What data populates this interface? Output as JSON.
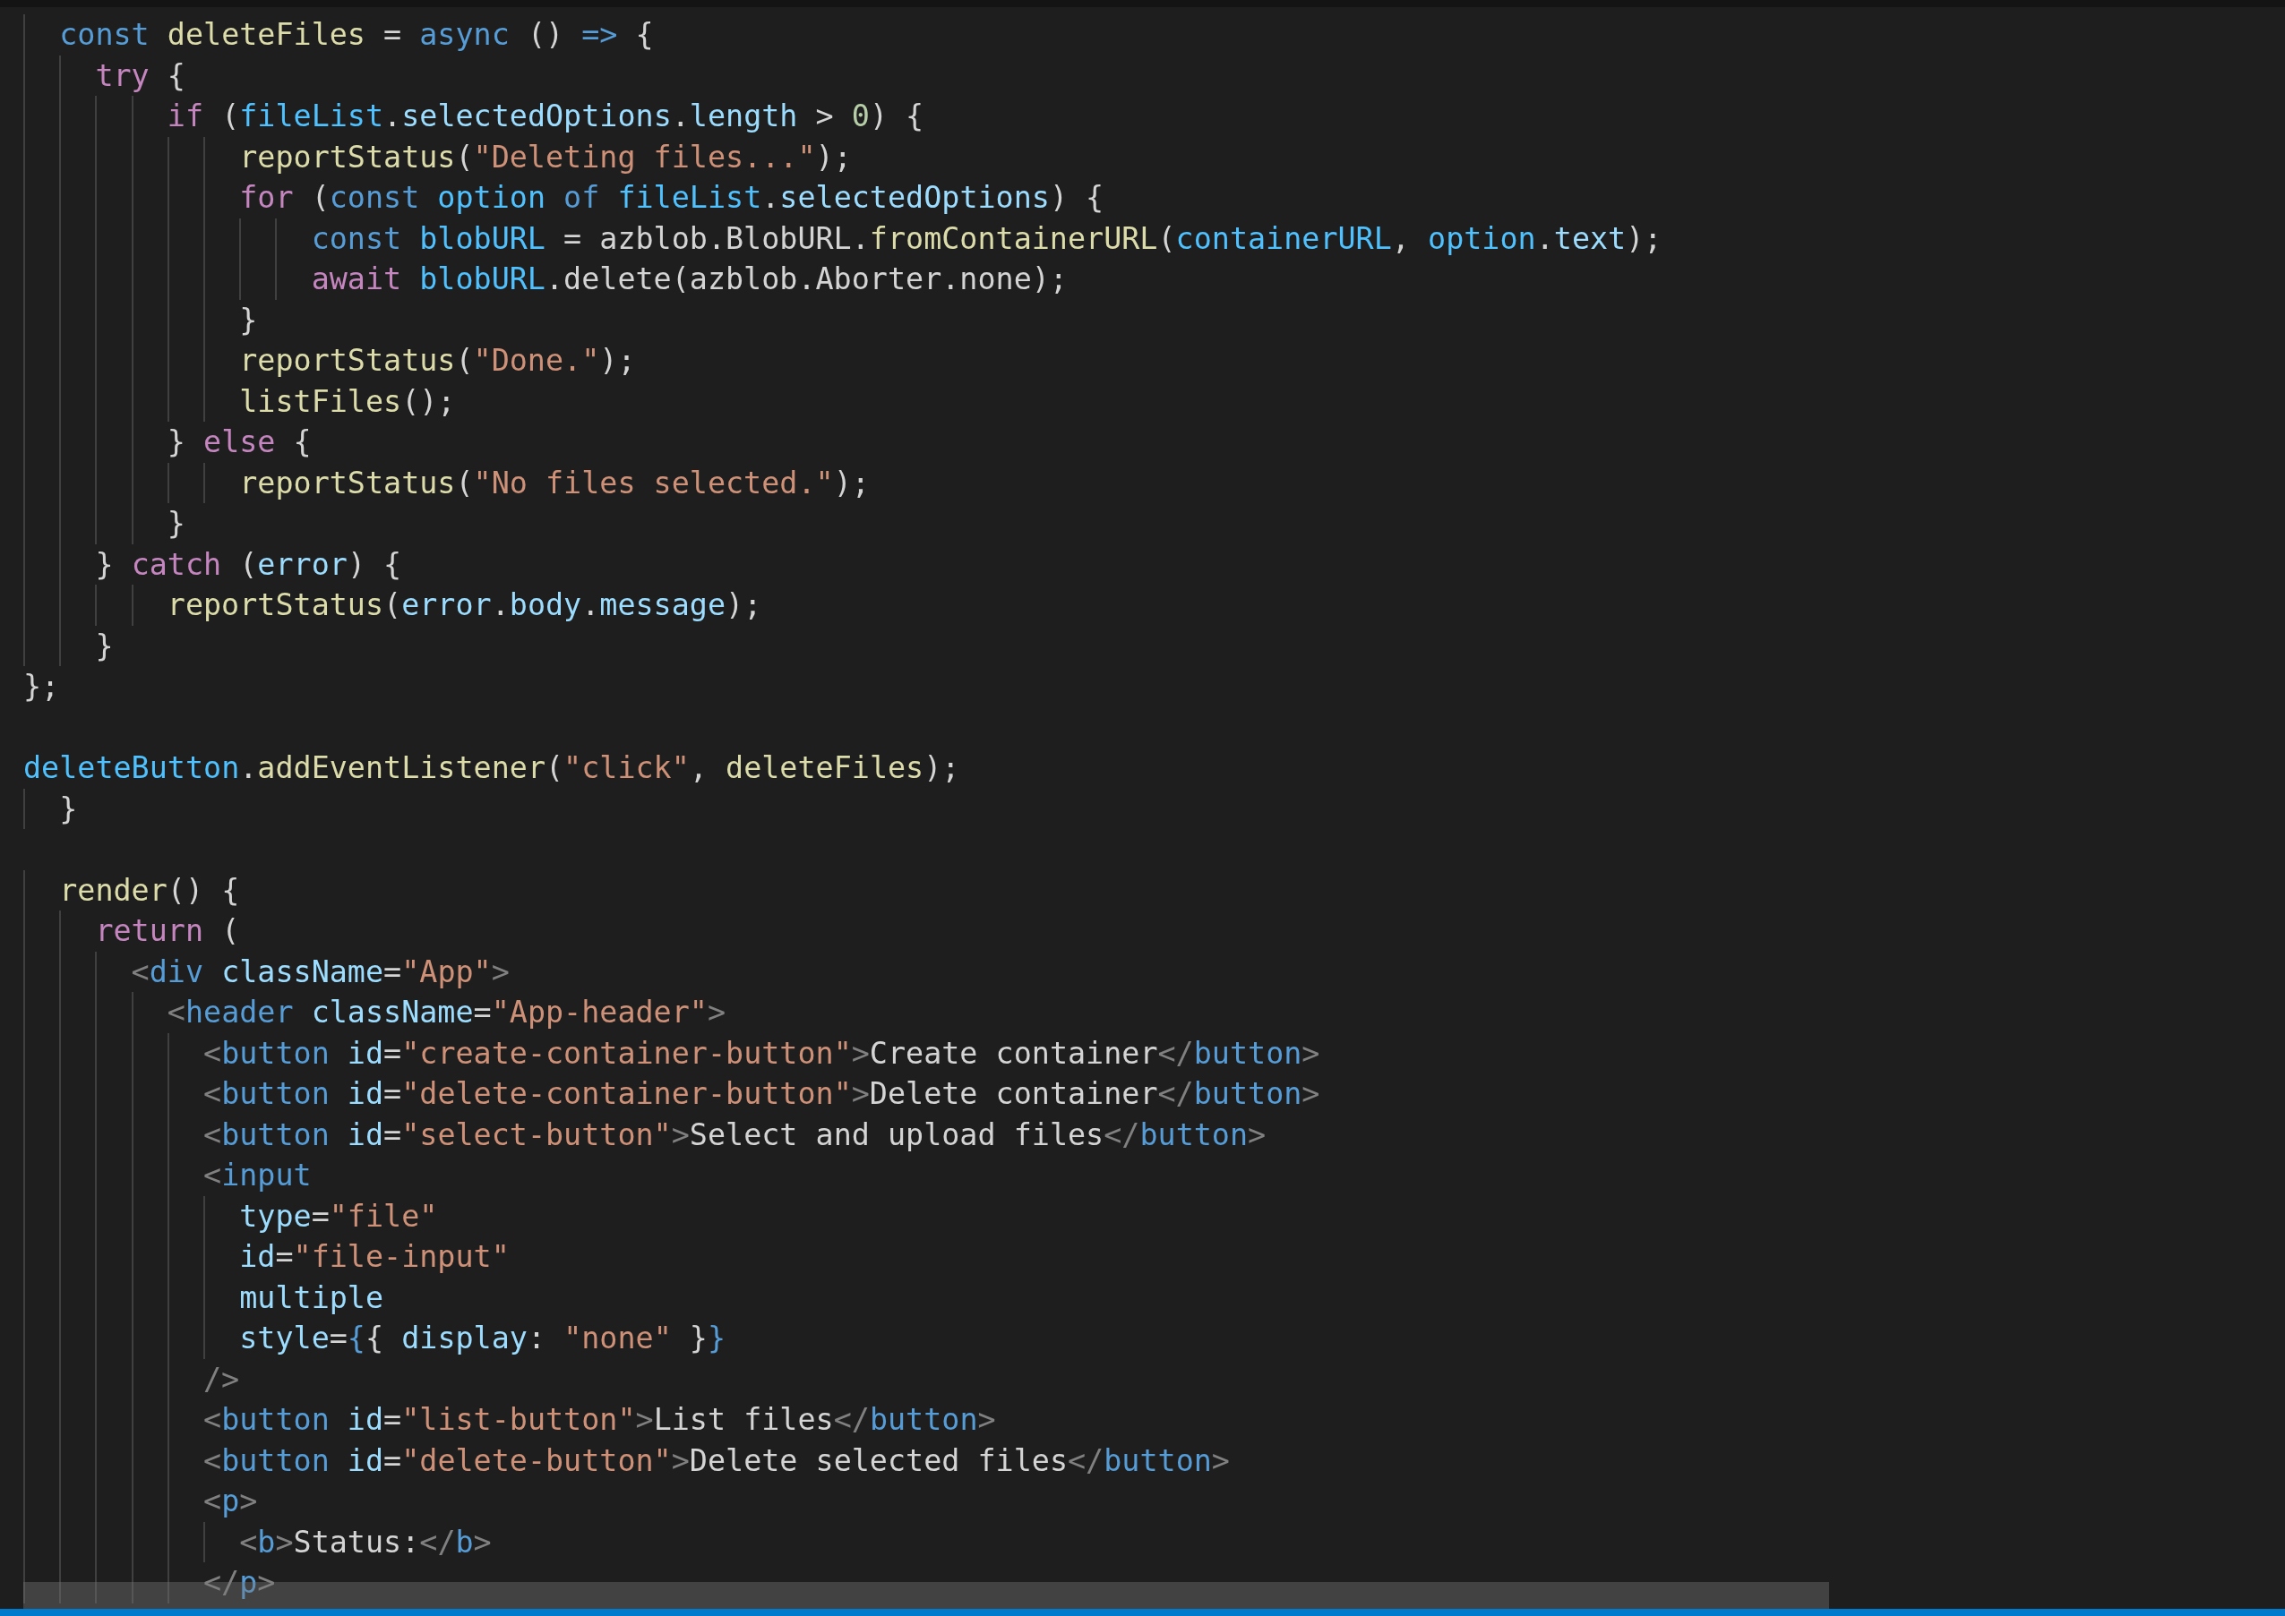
{
  "editor": {
    "lines": [
      {
        "tokens": [
          {
            "kind": "storage",
            "text": "  const"
          },
          {
            "kind": "fn",
            "text": " deleteFiles"
          },
          {
            "kind": "plain",
            "text": " = "
          },
          {
            "kind": "storage",
            "text": "async"
          },
          {
            "kind": "plain",
            "text": " () "
          },
          {
            "kind": "storage",
            "text": "=>"
          },
          {
            "kind": "plain",
            "text": " {"
          }
        ]
      },
      {
        "tokens": [
          {
            "kind": "kw",
            "text": "    try"
          },
          {
            "kind": "plain",
            "text": " {"
          }
        ]
      },
      {
        "tokens": [
          {
            "kind": "kw",
            "text": "        if"
          },
          {
            "kind": "plain",
            "text": " ("
          },
          {
            "kind": "const",
            "text": "fileList"
          },
          {
            "kind": "plain",
            "text": "."
          },
          {
            "kind": "var",
            "text": "selectedOptions"
          },
          {
            "kind": "plain",
            "text": "."
          },
          {
            "kind": "var",
            "text": "length"
          },
          {
            "kind": "plain",
            "text": " > "
          },
          {
            "kind": "num",
            "text": "0"
          },
          {
            "kind": "plain",
            "text": ") {"
          }
        ]
      },
      {
        "tokens": [
          {
            "kind": "fn",
            "text": "            reportStatus"
          },
          {
            "kind": "plain",
            "text": "("
          },
          {
            "kind": "str",
            "text": "\"Deleting files...\""
          },
          {
            "kind": "plain",
            "text": ");"
          }
        ]
      },
      {
        "tokens": [
          {
            "kind": "kw",
            "text": "            for"
          },
          {
            "kind": "plain",
            "text": " ("
          },
          {
            "kind": "storage",
            "text": "const"
          },
          {
            "kind": "const",
            "text": " option"
          },
          {
            "kind": "storage",
            "text": " of"
          },
          {
            "kind": "const",
            "text": " fileList"
          },
          {
            "kind": "plain",
            "text": "."
          },
          {
            "kind": "var",
            "text": "selectedOptions"
          },
          {
            "kind": "plain",
            "text": ") {"
          }
        ]
      },
      {
        "tokens": [
          {
            "kind": "storage",
            "text": "                const"
          },
          {
            "kind": "const",
            "text": " blobURL"
          },
          {
            "kind": "plain",
            "text": " = azblob.BlobURL."
          },
          {
            "kind": "fn",
            "text": "fromContainerURL"
          },
          {
            "kind": "plain",
            "text": "("
          },
          {
            "kind": "const",
            "text": "containerURL"
          },
          {
            "kind": "plain",
            "text": ", "
          },
          {
            "kind": "const",
            "text": "option"
          },
          {
            "kind": "plain",
            "text": "."
          },
          {
            "kind": "var",
            "text": "text"
          },
          {
            "kind": "plain",
            "text": ");"
          }
        ]
      },
      {
        "tokens": [
          {
            "kind": "kw",
            "text": "                await"
          },
          {
            "kind": "const",
            "text": " blobURL"
          },
          {
            "kind": "plain",
            "text": ".delete("
          },
          {
            "kind": "plain",
            "text": "azblob.Aborter.none);"
          }
        ]
      },
      {
        "tokens": [
          {
            "kind": "plain",
            "text": "            }"
          }
        ]
      },
      {
        "tokens": [
          {
            "kind": "fn",
            "text": "            reportStatus"
          },
          {
            "kind": "plain",
            "text": "("
          },
          {
            "kind": "str",
            "text": "\"Done.\""
          },
          {
            "kind": "plain",
            "text": ");"
          }
        ]
      },
      {
        "tokens": [
          {
            "kind": "fn",
            "text": "            listFiles"
          },
          {
            "kind": "plain",
            "text": "();"
          }
        ]
      },
      {
        "tokens": [
          {
            "kind": "plain",
            "text": "        } "
          },
          {
            "kind": "kw",
            "text": "else"
          },
          {
            "kind": "plain",
            "text": " {"
          }
        ]
      },
      {
        "tokens": [
          {
            "kind": "fn",
            "text": "            reportStatus"
          },
          {
            "kind": "plain",
            "text": "("
          },
          {
            "kind": "str",
            "text": "\"No files selected.\""
          },
          {
            "kind": "plain",
            "text": ");"
          }
        ]
      },
      {
        "tokens": [
          {
            "kind": "plain",
            "text": "        }"
          }
        ]
      },
      {
        "tokens": [
          {
            "kind": "plain",
            "text": "    } "
          },
          {
            "kind": "kw",
            "text": "catch"
          },
          {
            "kind": "plain",
            "text": " ("
          },
          {
            "kind": "var",
            "text": "error"
          },
          {
            "kind": "plain",
            "text": ") {"
          }
        ]
      },
      {
        "tokens": [
          {
            "kind": "fn",
            "text": "        reportStatus"
          },
          {
            "kind": "plain",
            "text": "("
          },
          {
            "kind": "var",
            "text": "error"
          },
          {
            "kind": "plain",
            "text": "."
          },
          {
            "kind": "var",
            "text": "body"
          },
          {
            "kind": "plain",
            "text": "."
          },
          {
            "kind": "var",
            "text": "message"
          },
          {
            "kind": "plain",
            "text": ");"
          }
        ]
      },
      {
        "tokens": [
          {
            "kind": "plain",
            "text": "    }"
          }
        ]
      },
      {
        "tokens": [
          {
            "kind": "plain",
            "text": "};"
          }
        ]
      },
      {
        "kind": "blank"
      },
      {
        "tokens": [
          {
            "kind": "const",
            "text": "deleteButton"
          },
          {
            "kind": "plain",
            "text": "."
          },
          {
            "kind": "fn",
            "text": "addEventListener"
          },
          {
            "kind": "plain",
            "text": "("
          },
          {
            "kind": "str",
            "text": "\"click\""
          },
          {
            "kind": "plain",
            "text": ", "
          },
          {
            "kind": "fn",
            "text": "deleteFiles"
          },
          {
            "kind": "plain",
            "text": ");"
          }
        ]
      },
      {
        "tokens": [
          {
            "kind": "plain",
            "text": "  }"
          }
        ]
      },
      {
        "kind": "blank"
      },
      {
        "tokens": [
          {
            "kind": "fn",
            "text": "  render"
          },
          {
            "kind": "plain",
            "text": "() {"
          }
        ]
      },
      {
        "tokens": [
          {
            "kind": "kw",
            "text": "    return"
          },
          {
            "kind": "plain",
            "text": " ("
          }
        ]
      },
      {
        "tokens": [
          {
            "kind": "bracket",
            "text": "      <"
          },
          {
            "kind": "tag",
            "text": "div"
          },
          {
            "kind": "var",
            "text": " className"
          },
          {
            "kind": "plain",
            "text": "="
          },
          {
            "kind": "str",
            "text": "\"App\""
          },
          {
            "kind": "bracket",
            "text": ">"
          }
        ]
      },
      {
        "tokens": [
          {
            "kind": "bracket",
            "text": "        <"
          },
          {
            "kind": "tag",
            "text": "header"
          },
          {
            "kind": "var",
            "text": " className"
          },
          {
            "kind": "plain",
            "text": "="
          },
          {
            "kind": "str",
            "text": "\"App-header\""
          },
          {
            "kind": "bracket",
            "text": ">"
          }
        ]
      },
      {
        "tokens": [
          {
            "kind": "bracket",
            "text": "          <"
          },
          {
            "kind": "tag",
            "text": "button"
          },
          {
            "kind": "var",
            "text": " id"
          },
          {
            "kind": "plain",
            "text": "="
          },
          {
            "kind": "str",
            "text": "\"create-container-button\""
          },
          {
            "kind": "bracket",
            "text": ">"
          },
          {
            "kind": "plain",
            "text": "Create container"
          },
          {
            "kind": "bracket",
            "text": "</"
          },
          {
            "kind": "tag",
            "text": "button"
          },
          {
            "kind": "bracket",
            "text": ">"
          }
        ]
      },
      {
        "tokens": [
          {
            "kind": "bracket",
            "text": "          <"
          },
          {
            "kind": "tag",
            "text": "button"
          },
          {
            "kind": "var",
            "text": " id"
          },
          {
            "kind": "plain",
            "text": "="
          },
          {
            "kind": "str",
            "text": "\"delete-container-button\""
          },
          {
            "kind": "bracket",
            "text": ">"
          },
          {
            "kind": "plain",
            "text": "Delete container"
          },
          {
            "kind": "bracket",
            "text": "</"
          },
          {
            "kind": "tag",
            "text": "button"
          },
          {
            "kind": "bracket",
            "text": ">"
          }
        ]
      },
      {
        "tokens": [
          {
            "kind": "bracket",
            "text": "          <"
          },
          {
            "kind": "tag",
            "text": "button"
          },
          {
            "kind": "var",
            "text": " id"
          },
          {
            "kind": "plain",
            "text": "="
          },
          {
            "kind": "str",
            "text": "\"select-button\""
          },
          {
            "kind": "bracket",
            "text": ">"
          },
          {
            "kind": "plain",
            "text": "Select and upload files"
          },
          {
            "kind": "bracket",
            "text": "</"
          },
          {
            "kind": "tag",
            "text": "button"
          },
          {
            "kind": "bracket",
            "text": ">"
          }
        ]
      },
      {
        "tokens": [
          {
            "kind": "bracket",
            "text": "          <"
          },
          {
            "kind": "tag",
            "text": "input"
          }
        ]
      },
      {
        "tokens": [
          {
            "kind": "var",
            "text": "            type"
          },
          {
            "kind": "plain",
            "text": "="
          },
          {
            "kind": "str",
            "text": "\"file\""
          }
        ]
      },
      {
        "tokens": [
          {
            "kind": "var",
            "text": "            id"
          },
          {
            "kind": "plain",
            "text": "="
          },
          {
            "kind": "str",
            "text": "\"file-input\""
          }
        ]
      },
      {
        "tokens": [
          {
            "kind": "var",
            "text": "            multiple"
          }
        ]
      },
      {
        "tokens": [
          {
            "kind": "var",
            "text": "            style"
          },
          {
            "kind": "plain",
            "text": "="
          },
          {
            "kind": "tag",
            "text": "{"
          },
          {
            "kind": "plain",
            "text": "{ "
          },
          {
            "kind": "var",
            "text": "display"
          },
          {
            "kind": "plain",
            "text": ": "
          },
          {
            "kind": "str",
            "text": "\"none\""
          },
          {
            "kind": "plain",
            "text": " }"
          },
          {
            "kind": "tag",
            "text": "}"
          }
        ]
      },
      {
        "tokens": [
          {
            "kind": "bracket",
            "text": "          />"
          }
        ]
      },
      {
        "tokens": [
          {
            "kind": "bracket",
            "text": "          <"
          },
          {
            "kind": "tag",
            "text": "button"
          },
          {
            "kind": "var",
            "text": " id"
          },
          {
            "kind": "plain",
            "text": "="
          },
          {
            "kind": "str",
            "text": "\"list-button\""
          },
          {
            "kind": "bracket",
            "text": ">"
          },
          {
            "kind": "plain",
            "text": "List files"
          },
          {
            "kind": "bracket",
            "text": "</"
          },
          {
            "kind": "tag",
            "text": "button"
          },
          {
            "kind": "bracket",
            "text": ">"
          }
        ]
      },
      {
        "tokens": [
          {
            "kind": "bracket",
            "text": "          <"
          },
          {
            "kind": "tag",
            "text": "button"
          },
          {
            "kind": "var",
            "text": " id"
          },
          {
            "kind": "plain",
            "text": "="
          },
          {
            "kind": "str",
            "text": "\"delete-button\""
          },
          {
            "kind": "bracket",
            "text": ">"
          },
          {
            "kind": "plain",
            "text": "Delete selected files"
          },
          {
            "kind": "bracket",
            "text": "</"
          },
          {
            "kind": "tag",
            "text": "button"
          },
          {
            "kind": "bracket",
            "text": ">"
          }
        ]
      },
      {
        "tokens": [
          {
            "kind": "bracket",
            "text": "          <"
          },
          {
            "kind": "tag",
            "text": "p"
          },
          {
            "kind": "bracket",
            "text": ">"
          }
        ]
      },
      {
        "tokens": [
          {
            "kind": "bracket",
            "text": "            <"
          },
          {
            "kind": "tag",
            "text": "b"
          },
          {
            "kind": "bracket",
            "text": ">"
          },
          {
            "kind": "plain",
            "text": "Status:"
          },
          {
            "kind": "bracket",
            "text": "</"
          },
          {
            "kind": "tag",
            "text": "b"
          },
          {
            "kind": "bracket",
            "text": ">"
          }
        ]
      },
      {
        "tokens": [
          {
            "kind": "bracket",
            "text": "          </"
          },
          {
            "kind": "tag",
            "text": "p"
          },
          {
            "kind": "bracket",
            "text": ">"
          }
        ]
      }
    ]
  }
}
